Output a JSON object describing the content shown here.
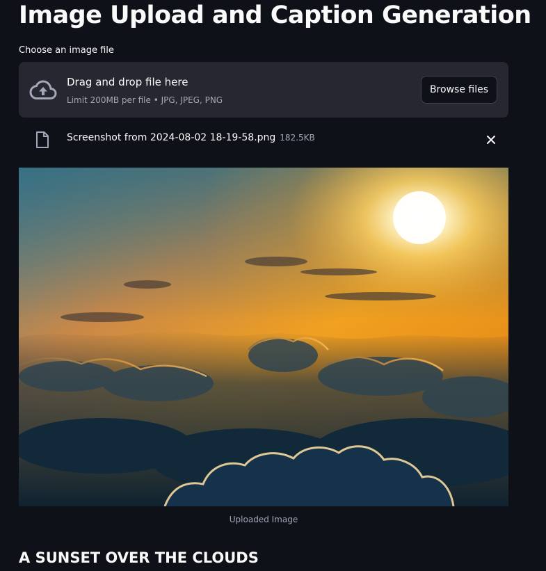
{
  "page": {
    "title": "Image Upload and Caption Generation"
  },
  "uploader": {
    "label": "Choose an image file",
    "drop_title": "Drag and drop file here",
    "drop_limit": "Limit 200MB per file • JPG, JPEG, PNG",
    "browse_label": "Browse files",
    "cloud_icon": "cloud-upload-icon"
  },
  "uploaded_file": {
    "name": "Screenshot from 2024-08-02 18-19-58.png",
    "size": "182.5KB",
    "file_icon": "file-icon",
    "remove_icon": "close-icon"
  },
  "image": {
    "caption": "Uploaded Image"
  },
  "result": {
    "generated_caption": "A SUNSET OVER THE CLOUDS"
  },
  "colors": {
    "background": "#0e1117",
    "dropzone": "#262730",
    "text": "#fafafa",
    "muted_text": "#a3a8b8"
  }
}
